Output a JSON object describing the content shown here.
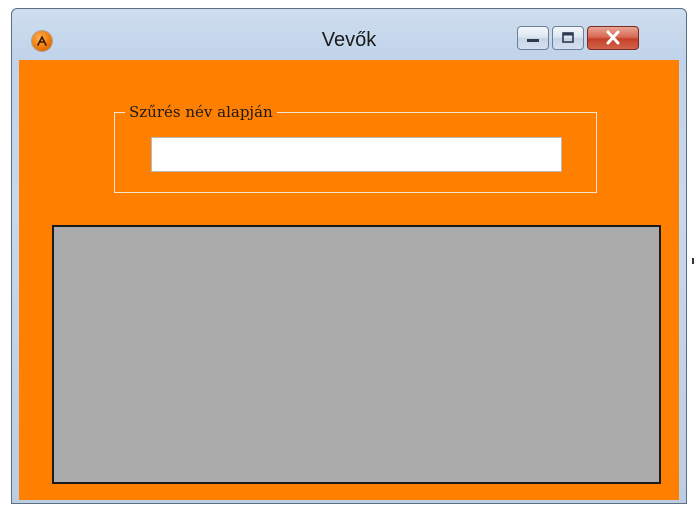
{
  "window": {
    "title": "Vevők",
    "app_icon": "app-logo-icon",
    "controls": {
      "minimize_icon": "minimize-icon",
      "maximize_icon": "maximize-icon",
      "close_icon": "close-icon"
    }
  },
  "filter": {
    "group_label": "Szűrés név alapján",
    "value": "",
    "placeholder": ""
  },
  "customers_grid": {
    "rows": []
  },
  "colors": {
    "client_background": "#ff7f00",
    "grid_background": "#ababab",
    "close_button": "#c4402a"
  }
}
